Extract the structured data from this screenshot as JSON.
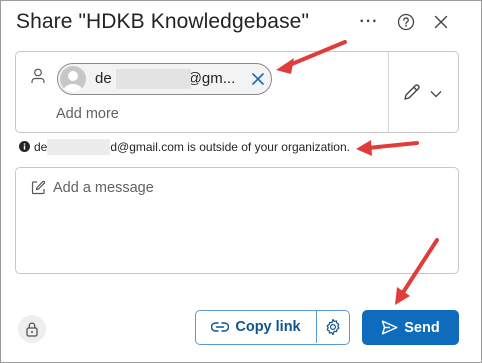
{
  "dialog": {
    "title": "Share \"HDKB Knowledgebase\"",
    "more_icon": "more-horizontal-icon",
    "help_icon": "help-circle-icon",
    "close_icon": "close-icon"
  },
  "recipients": {
    "field_icon": "person-icon",
    "chip": {
      "text_start": "de",
      "text_end": "@gm...",
      "remove_icon": "close-icon"
    },
    "add_more_placeholder": "Add more",
    "permission_icon": "pencil-icon",
    "permission_dropdown_icon": "chevron-down-icon"
  },
  "notice": {
    "icon": "info-icon",
    "text_start": "de",
    "text_end": "d@gmail.com is outside of your organization."
  },
  "message": {
    "icon": "compose-icon",
    "placeholder": "Add a message"
  },
  "footer": {
    "lock_icon": "lock-icon",
    "copy_link_label": "Copy link",
    "copy_link_icon": "link-icon",
    "settings_icon": "gear-icon",
    "send_label": "Send",
    "send_icon": "send-icon"
  },
  "colors": {
    "primary": "#0f6cbd",
    "link_text": "#0f548c",
    "copy_border": "#5b9bd5",
    "annotation_arrow": "#e03c3c"
  }
}
